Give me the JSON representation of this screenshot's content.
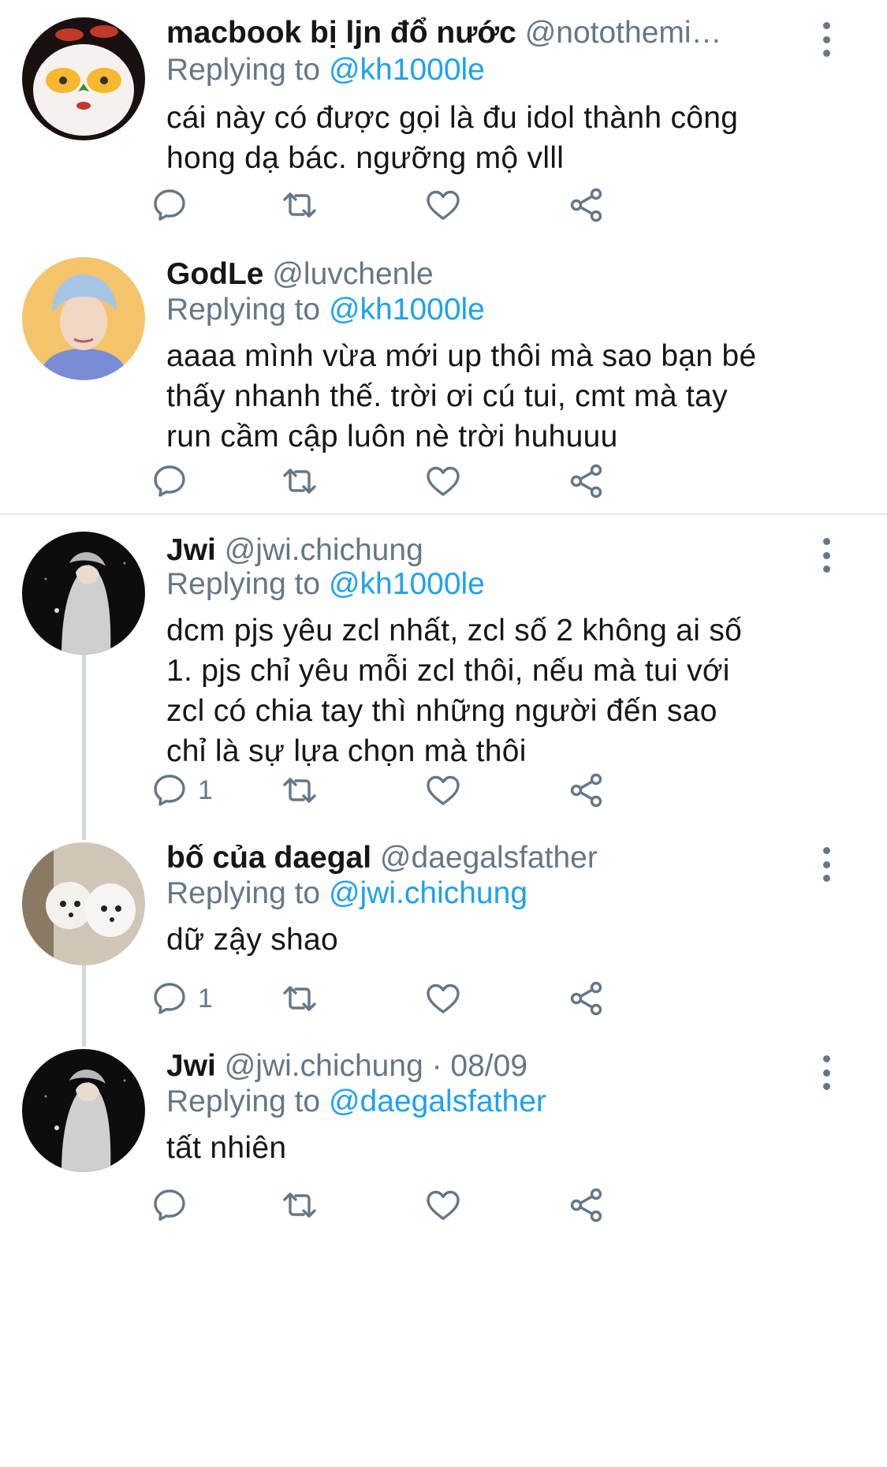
{
  "accent_color": "#1da1f2",
  "muted_color": "#657786",
  "tweets": [
    {
      "name": "macbook bị ljn đổ nước",
      "handle": "@notothemi…",
      "replying_label": "Replying to",
      "replying_to": "@kh1000le",
      "text_lines": [
        "cái này có được gọi là đu idol thành công",
        "hong dạ bác. ngưỡng mộ vlll"
      ],
      "reply_count": "",
      "avatar": "avatar-cartoon-egg-eyes"
    },
    {
      "name": "GodLe",
      "handle": "@luvchenle",
      "replying_label": "Replying to",
      "replying_to": "@kh1000le",
      "text_lines": [
        "aaaa mình vừa mới up thôi mà sao bạn bé",
        "thấy nhanh thế. trời ơi cú tui, cmt mà tay",
        "run cầm cập luôn nè trời huhuuu"
      ],
      "reply_count": "",
      "avatar": "avatar-blue-hair-person"
    },
    {
      "name": "Jwi",
      "handle": "@jwi.chichung",
      "replying_label": "Replying to",
      "replying_to": "@kh1000le",
      "text_lines": [
        "dcm pjs yêu zcl nhất, zcl số 2 không ai số",
        "1. pjs chỉ yêu mỗi zcl thôi, nếu mà tui với",
        "zcl có chia tay thì những người đến sao",
        "chỉ là sự lựa chọn mà thôi"
      ],
      "reply_count": "1",
      "avatar": "avatar-hooded-person"
    },
    {
      "name": "bố của daegal",
      "handle": "@daegalsfather",
      "replying_label": "Replying to",
      "replying_to": "@jwi.chichung",
      "text_lines": [
        "dữ zậy shao"
      ],
      "reply_count": "1",
      "avatar": "avatar-white-dogs"
    },
    {
      "name": "Jwi",
      "handle": "@jwi.chichung · 08/09",
      "replying_label": "Replying to",
      "replying_to": "@daegalsfather",
      "text_lines": [
        "tất nhiên"
      ],
      "reply_count": "",
      "avatar": "avatar-hooded-person"
    }
  ]
}
